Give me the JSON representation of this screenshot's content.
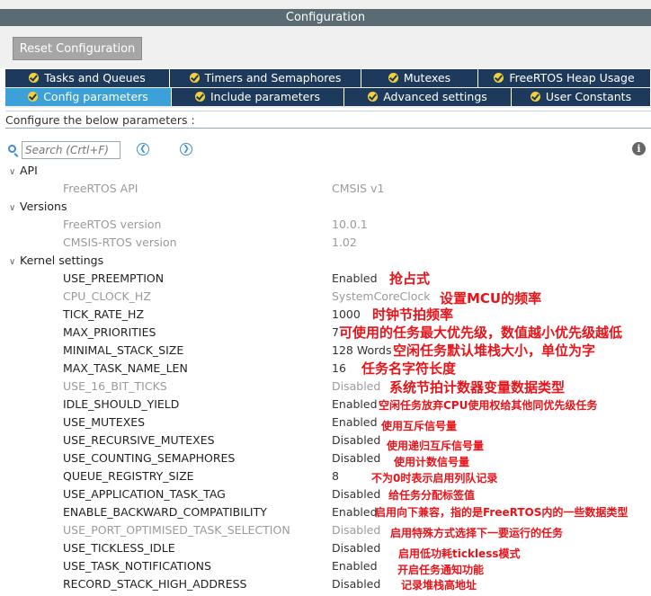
{
  "window": {
    "title": "Configuration"
  },
  "toolbar": {
    "reset_label": "Reset Configuration"
  },
  "tabs_row1": [
    {
      "label": "Tasks and Queues"
    },
    {
      "label": "Timers and Semaphores"
    },
    {
      "label": "Mutexes"
    },
    {
      "label": "FreeRTOS Heap Usage"
    }
  ],
  "tabs_row2": [
    {
      "label": "Config parameters"
    },
    {
      "label": "Include parameters"
    },
    {
      "label": "Advanced settings"
    },
    {
      "label": "User Constants"
    }
  ],
  "configure_text": "Configure the below parameters :",
  "search": {
    "placeholder": "Search (Crtl+F)"
  },
  "groups": {
    "api": "API",
    "versions": "Versions",
    "kernel": "Kernel settings"
  },
  "params": {
    "freertos_api": {
      "name": "FreeRTOS API",
      "value": "CMSIS v1"
    },
    "freertos_version": {
      "name": "FreeRTOS version",
      "value": "10.0.1"
    },
    "cmsis_version": {
      "name": "CMSIS-RTOS version",
      "value": "1.02"
    },
    "use_preemption": {
      "name": "USE_PREEMPTION",
      "value": "Enabled",
      "note": "抢占式"
    },
    "cpu_clock_hz": {
      "name": "CPU_CLOCK_HZ",
      "value": "SystemCoreClock",
      "note": "设置MCU的频率"
    },
    "tick_rate_hz": {
      "name": "TICK_RATE_HZ",
      "value": "1000",
      "note": "时钟节拍频率"
    },
    "max_priorities": {
      "name": "MAX_PRIORITIES",
      "value": "7",
      "note": "可使用的任务最大优先级，数值越小优先级越低"
    },
    "minimal_stack_size": {
      "name": "MINIMAL_STACK_SIZE",
      "value": "128 Words",
      "note": "空闲任务默认堆栈大小，单位为字"
    },
    "max_task_name_len": {
      "name": "MAX_TASK_NAME_LEN",
      "value": "16",
      "note": "任务名字符长度"
    },
    "use_16_bit_ticks": {
      "name": "USE_16_BIT_TICKS",
      "value": "Disabled",
      "note": "系统节拍计数器变量数据类型"
    },
    "idle_should_yield": {
      "name": "IDLE_SHOULD_YIELD",
      "value": "Enabled",
      "note": "空闲任务放弃CPU使用权给其他同优先级任务"
    },
    "use_mutexes": {
      "name": "USE_MUTEXES",
      "value": "Enabled",
      "note": "使用互斥信号量"
    },
    "use_recursive_mutexes": {
      "name": "USE_RECURSIVE_MUTEXES",
      "value": "Disabled",
      "note": "使用递归互斥信号量"
    },
    "use_counting_semaphores": {
      "name": "USE_COUNTING_SEMAPHORES",
      "value": "Disabled",
      "note": "使用计数信号量"
    },
    "queue_registry_size": {
      "name": "QUEUE_REGISTRY_SIZE",
      "value": "8",
      "note": "不为0时表示启用列队记录"
    },
    "use_application_task_tag": {
      "name": "USE_APPLICATION_TASK_TAG",
      "value": "Disabled",
      "note": "给任务分配标签值"
    },
    "enable_backward_compatibility": {
      "name": "ENABLE_BACKWARD_COMPATIBILITY",
      "value": "Enabled",
      "note": "启用向下兼容，指的是FreeRTOS内的一些数据类型"
    },
    "use_port_optimised_task_selection": {
      "name": "USE_PORT_OPTIMISED_TASK_SELECTION",
      "value": "Disabled",
      "note": "启用特殊方式选择下一要运行的任务"
    },
    "use_tickless_idle": {
      "name": "USE_TICKLESS_IDLE",
      "value": "Disabled",
      "note": "启用低功耗tickless模式"
    },
    "use_task_notifications": {
      "name": "USE_TASK_NOTIFICATIONS",
      "value": "Enabled",
      "note": "开启任务通知功能"
    },
    "record_stack_high_address": {
      "name": "RECORD_STACK_HIGH_ADDRESS",
      "value": "Disabled",
      "note": "记录堆栈高地址"
    }
  },
  "colors": {
    "tab_bg": "#1d3a5c",
    "tab_active": "#3ba1d8",
    "title_bg": "#5b6b73",
    "note": "#e8141a"
  }
}
